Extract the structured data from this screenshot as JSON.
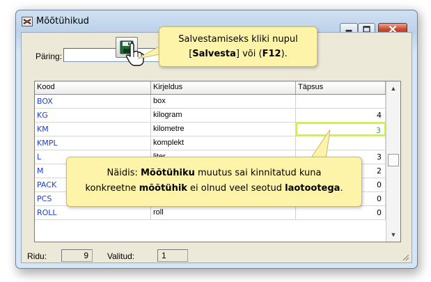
{
  "window": {
    "title": "Mõõtühikud",
    "accent_color": "#c64a32"
  },
  "toolbar": {
    "query_label": "Päring:",
    "query_value": "",
    "save_icon": "floppy-disk-icon",
    "cursor_icon": "hand-pointer-icon"
  },
  "grid": {
    "columns": [
      "Kood",
      "Kirjeldus",
      "Täpsus"
    ],
    "rows": [
      {
        "code": "BOX",
        "description": "box",
        "precision": ""
      },
      {
        "code": "KG",
        "description": "kilogram",
        "precision": "4"
      },
      {
        "code": "KM",
        "description": "kilometre",
        "precision": "3"
      },
      {
        "code": "KMPL",
        "description": "komplekt",
        "precision": ""
      },
      {
        "code": "L",
        "description": "liter",
        "precision": "3"
      },
      {
        "code": "M",
        "description": "",
        "precision": "2"
      },
      {
        "code": "PACK",
        "description": "",
        "precision": "0"
      },
      {
        "code": "PCS",
        "description": "",
        "precision": "0"
      },
      {
        "code": "ROLL",
        "description": "roll",
        "precision": "0"
      }
    ]
  },
  "status": {
    "rows_label": "Ridu:",
    "rows_value": "9",
    "selected_label": "Valitud:",
    "selected_value": "1"
  },
  "callouts": {
    "top": {
      "line1": "Salvestamiseks kliki nupul",
      "l2_a": "[",
      "l2_b": "Salvesta",
      "l2_c": "] või (",
      "l2_d": "F12",
      "l2_e": ")."
    },
    "bottom": {
      "l1_a": "Näidis: ",
      "l1_b": "Mõõtühiku",
      "l1_c": " muutus sai kinnitatud kuna",
      "l2_a": "konkreetne ",
      "l2_b": "mõõtühik",
      "l2_c": " ei olnud veel seotud ",
      "l2_d": "laotootega",
      "l2_e": "."
    },
    "fill_color": "#fdf4a9",
    "highlight_color": "#d6ef3a"
  }
}
